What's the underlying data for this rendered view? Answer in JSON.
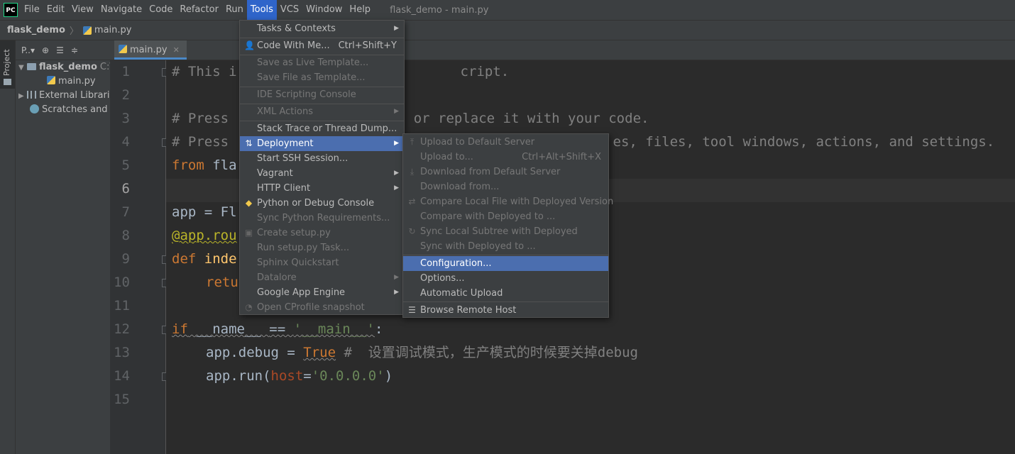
{
  "menubar": {
    "logo": "PC",
    "items": [
      "File",
      "Edit",
      "View",
      "Navigate",
      "Code",
      "Refactor",
      "Run",
      "Tools",
      "VCS",
      "Window",
      "Help"
    ],
    "active": "Tools",
    "window_title": "flask_demo - main.py"
  },
  "breadcrumb": {
    "project": "flask_demo",
    "file": "main.py"
  },
  "tool_strip": {
    "project_label": "Project"
  },
  "project_panel": {
    "toolbar": {
      "view_label": "P..▾"
    },
    "tree": [
      {
        "label": "flask_demo",
        "suffix": "C:\\",
        "icon": "folder-icon"
      },
      {
        "label": "main.py",
        "icon": "python-file-icon"
      },
      {
        "label": "External Libraries",
        "icon": "library-icon"
      },
      {
        "label": "Scratches and C",
        "icon": "scratches-icon"
      }
    ]
  },
  "editor": {
    "tab_label": "main.py",
    "line_numbers": [
      "1",
      "2",
      "3",
      "4",
      "5",
      "6",
      "7",
      "8",
      "9",
      "10",
      "11",
      "12",
      "13",
      "14",
      "15"
    ],
    "visible_code": {
      "l1": "# This i",
      "l1b": "cript.",
      "l3": "# Press ",
      "l3b": "e it or replace it with your code.",
      "l4": "# Press ",
      "l4b": "es, files, tool windows, actions, and settings.",
      "l5_kw": "from",
      "l5_rest": " fla",
      "l7": "app = Fl",
      "l8": "@app.rou",
      "l9_kw": "def",
      "l9_rest": " inde",
      "l10_kw": "retu",
      "l12_kw": "if",
      "l12_name": " __name__ ",
      "l12_op": "== ",
      "l12_str": "'__main__'",
      "l12_end": ":",
      "l13_obj": "app.debug = ",
      "l13_kw": "True",
      "l13_comment": " #  设置调试模式，生产模式的时候要关掉debug",
      "l14_obj": "app.run(",
      "l14_param": "host",
      "l14_eq": "=",
      "l14_str": "'0.0.0.0'",
      "l14_end": ")"
    }
  },
  "tools_menu": {
    "items": [
      {
        "label": "Tasks & Contexts",
        "submenu": true
      },
      {
        "label": "Code With Me...",
        "shortcut": "Ctrl+Shift+Y",
        "icon": "user-icon"
      },
      {
        "label": "Save as Live Template...",
        "disabled": true
      },
      {
        "label": "Save File as Template...",
        "disabled": true
      },
      {
        "label": "IDE Scripting Console",
        "disabled": true
      },
      {
        "label": "XML Actions",
        "disabled": true,
        "submenu": true
      },
      {
        "label": "Stack Trace or Thread Dump..."
      },
      {
        "label": "Deployment",
        "submenu": true,
        "selected": true,
        "icon": "deployment-icon"
      },
      {
        "label": "Start SSH Session..."
      },
      {
        "label": "Vagrant",
        "submenu": true
      },
      {
        "label": "HTTP Client",
        "submenu": true
      },
      {
        "label": "Python or Debug Console",
        "icon": "python-console-icon"
      },
      {
        "label": "Sync Python Requirements...",
        "disabled": true
      },
      {
        "label": "Create setup.py",
        "disabled": true,
        "icon": "setup-icon"
      },
      {
        "label": "Run setup.py Task...",
        "disabled": true
      },
      {
        "label": "Sphinx Quickstart",
        "disabled": true
      },
      {
        "label": "Datalore",
        "disabled": true,
        "submenu": true
      },
      {
        "label": "Google App Engine",
        "submenu": true
      },
      {
        "label": "Open CProfile snapshot",
        "disabled": true,
        "icon": "profile-icon"
      }
    ]
  },
  "deployment_menu": {
    "items": [
      {
        "label": "Upload to Default Server",
        "disabled": true,
        "icon": "upload-icon"
      },
      {
        "label": "Upload to...",
        "disabled": true,
        "shortcut": "Ctrl+Alt+Shift+X"
      },
      {
        "label": "Download from Default Server",
        "disabled": true,
        "icon": "download-icon"
      },
      {
        "label": "Download from...",
        "disabled": true
      },
      {
        "label": "Compare Local File with Deployed Version",
        "disabled": true,
        "icon": "compare-icon"
      },
      {
        "label": "Compare with Deployed to ...",
        "disabled": true
      },
      {
        "label": "Sync Local Subtree with Deployed",
        "disabled": true,
        "icon": "sync-icon"
      },
      {
        "label": "Sync with Deployed to ...",
        "disabled": true
      },
      {
        "label": "Configuration...",
        "selected": true
      },
      {
        "label": "Options..."
      },
      {
        "label": "Automatic Upload"
      },
      {
        "label": "Browse Remote Host",
        "icon": "browse-remote-icon"
      }
    ]
  }
}
